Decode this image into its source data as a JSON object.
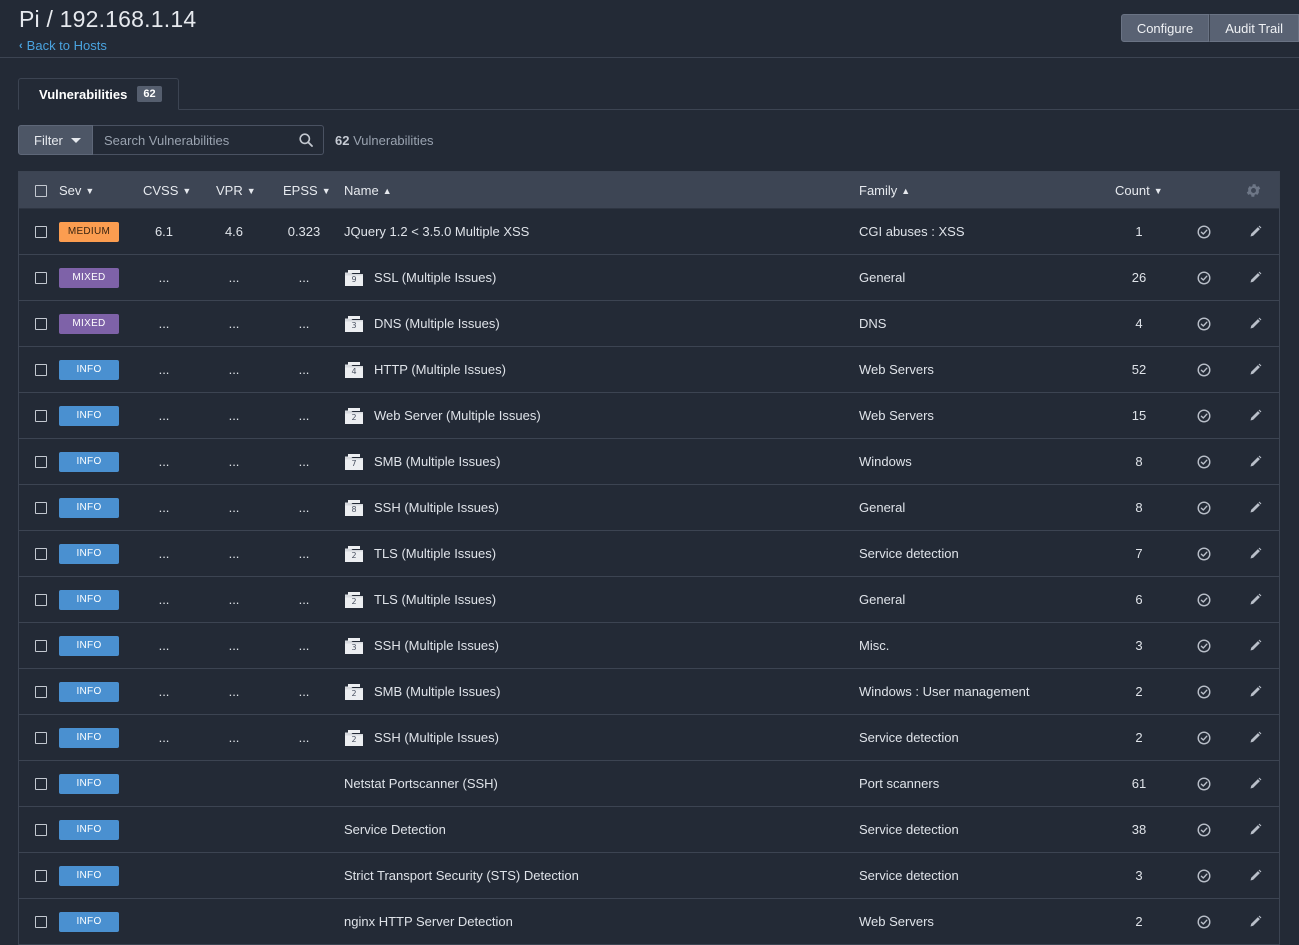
{
  "header": {
    "title": "Pi / 192.168.1.14",
    "back_label": "Back to Hosts",
    "configure_label": "Configure",
    "audit_trail_label": "Audit Trail"
  },
  "tabs": [
    {
      "label": "Vulnerabilities",
      "count": "62"
    }
  ],
  "toolbar": {
    "filter_label": "Filter",
    "search_placeholder": "Search Vulnerabilities",
    "result_count": "62",
    "result_label": "Vulnerabilities"
  },
  "columns": {
    "sev": "Sev",
    "cvss": "CVSS",
    "vpr": "VPR",
    "epss": "EPSS",
    "name": "Name",
    "family": "Family",
    "count": "Count"
  },
  "rows": [
    {
      "sev": "MEDIUM",
      "cvss": "6.1",
      "vpr": "4.6",
      "epss": "0.323",
      "group": "",
      "name": "JQuery 1.2 < 3.5.0 Multiple XSS",
      "family": "CGI abuses : XSS",
      "count": "1"
    },
    {
      "sev": "MIXED",
      "cvss": "...",
      "vpr": "...",
      "epss": "...",
      "group": "9",
      "name": "SSL (Multiple Issues)",
      "family": "General",
      "count": "26"
    },
    {
      "sev": "MIXED",
      "cvss": "...",
      "vpr": "...",
      "epss": "...",
      "group": "3",
      "name": "DNS (Multiple Issues)",
      "family": "DNS",
      "count": "4"
    },
    {
      "sev": "INFO",
      "cvss": "...",
      "vpr": "...",
      "epss": "...",
      "group": "4",
      "name": "HTTP (Multiple Issues)",
      "family": "Web Servers",
      "count": "52"
    },
    {
      "sev": "INFO",
      "cvss": "...",
      "vpr": "...",
      "epss": "...",
      "group": "2",
      "name": "Web Server (Multiple Issues)",
      "family": "Web Servers",
      "count": "15"
    },
    {
      "sev": "INFO",
      "cvss": "...",
      "vpr": "...",
      "epss": "...",
      "group": "7",
      "name": "SMB (Multiple Issues)",
      "family": "Windows",
      "count": "8"
    },
    {
      "sev": "INFO",
      "cvss": "...",
      "vpr": "...",
      "epss": "...",
      "group": "8",
      "name": "SSH (Multiple Issues)",
      "family": "General",
      "count": "8"
    },
    {
      "sev": "INFO",
      "cvss": "...",
      "vpr": "...",
      "epss": "...",
      "group": "2",
      "name": "TLS (Multiple Issues)",
      "family": "Service detection",
      "count": "7"
    },
    {
      "sev": "INFO",
      "cvss": "...",
      "vpr": "...",
      "epss": "...",
      "group": "2",
      "name": "TLS (Multiple Issues)",
      "family": "General",
      "count": "6"
    },
    {
      "sev": "INFO",
      "cvss": "...",
      "vpr": "...",
      "epss": "...",
      "group": "3",
      "name": "SSH (Multiple Issues)",
      "family": "Misc.",
      "count": "3"
    },
    {
      "sev": "INFO",
      "cvss": "...",
      "vpr": "...",
      "epss": "...",
      "group": "2",
      "name": "SMB (Multiple Issues)",
      "family": "Windows : User management",
      "count": "2"
    },
    {
      "sev": "INFO",
      "cvss": "...",
      "vpr": "...",
      "epss": "...",
      "group": "2",
      "name": "SSH (Multiple Issues)",
      "family": "Service detection",
      "count": "2"
    },
    {
      "sev": "INFO",
      "cvss": "",
      "vpr": "",
      "epss": "",
      "group": "",
      "name": "Netstat Portscanner (SSH)",
      "family": "Port scanners",
      "count": "61"
    },
    {
      "sev": "INFO",
      "cvss": "",
      "vpr": "",
      "epss": "",
      "group": "",
      "name": "Service Detection",
      "family": "Service detection",
      "count": "38"
    },
    {
      "sev": "INFO",
      "cvss": "",
      "vpr": "",
      "epss": "",
      "group": "",
      "name": "Strict Transport Security (STS) Detection",
      "family": "Service detection",
      "count": "3"
    },
    {
      "sev": "INFO",
      "cvss": "",
      "vpr": "",
      "epss": "",
      "group": "",
      "name": "nginx HTTP Server Detection",
      "family": "Web Servers",
      "count": "2"
    }
  ],
  "colors": {
    "medium": "#fc9d50",
    "mixed": "#7e62a8",
    "info": "#4a90d0",
    "link": "#4aa3df"
  },
  "icons": {
    "row_action_1": "check-circle-icon",
    "row_action_2": "pencil-icon",
    "settings": "gear-icon"
  }
}
